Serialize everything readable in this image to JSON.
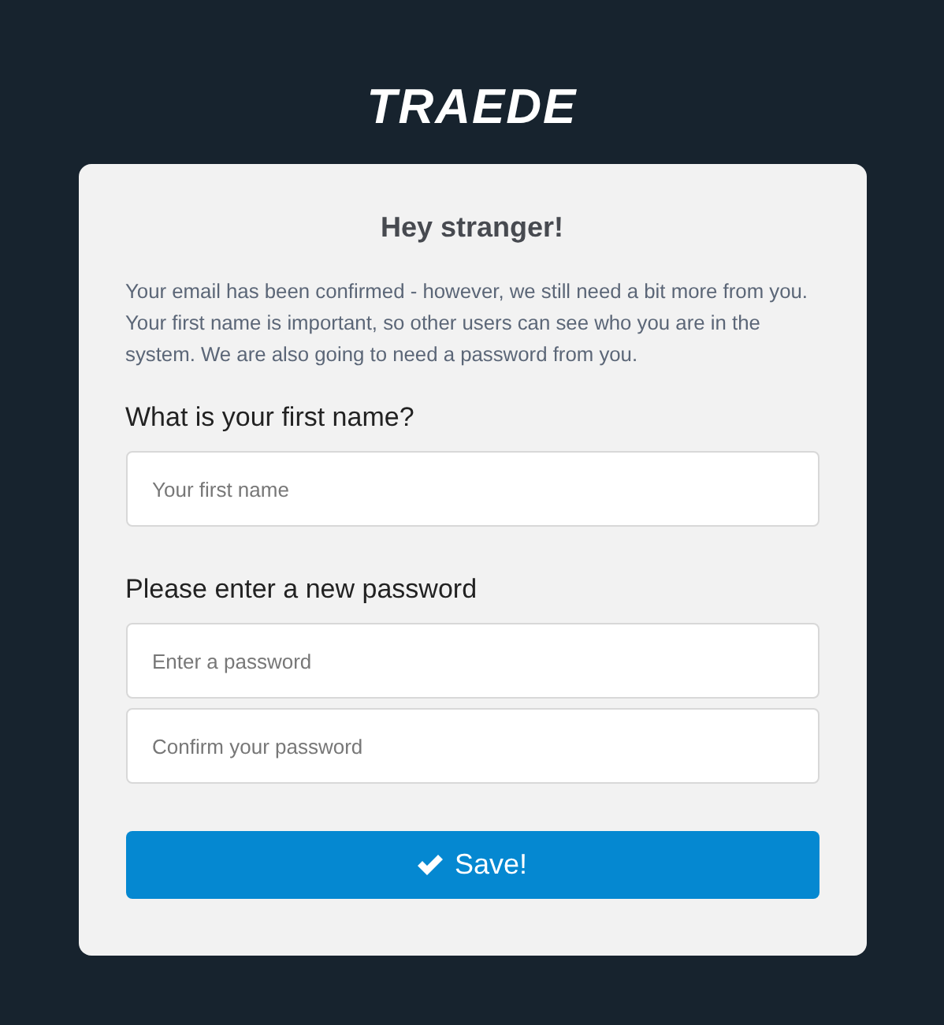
{
  "logo": "TRAEDE",
  "card": {
    "title": "Hey stranger!",
    "intro": "Your email has been confirmed - however, we still need a bit more from you. Your first name is important, so other users can see who you are in the system. We are also going to need a password from you.",
    "sections": [
      {
        "label": "What is your first name?",
        "fields": [
          {
            "placeholder": "Your first name"
          }
        ]
      },
      {
        "label": "Please enter a new password",
        "fields": [
          {
            "placeholder": "Enter a password"
          },
          {
            "placeholder": "Confirm your password"
          }
        ]
      }
    ],
    "button": "Save!"
  }
}
